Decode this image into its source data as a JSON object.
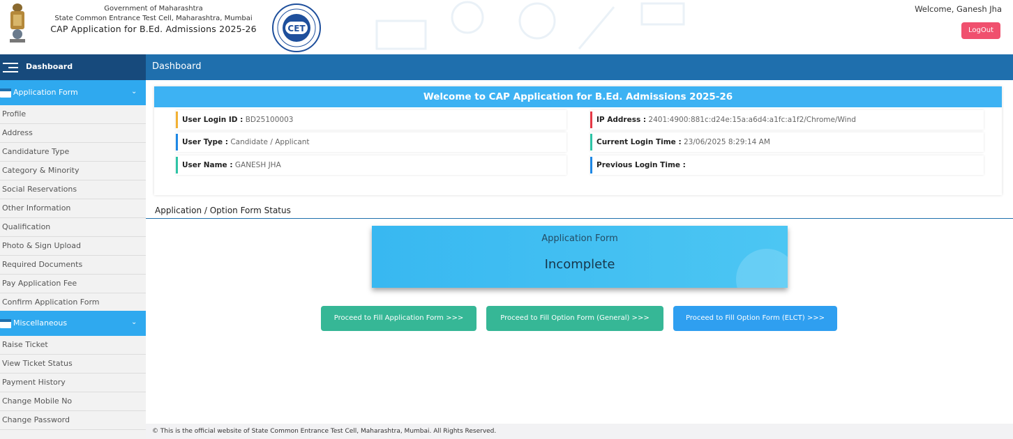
{
  "header": {
    "gov_line": "Government of Maharashtra",
    "cell_line": "State Common Entrance Test Cell, Maharashtra, Mumbai",
    "app_line": "CAP Application for B.Ed. Admissions 2025-26",
    "cet_logo_text": "CET",
    "welcome_text": "Welcome, Ganesh Jha",
    "logout_label": "LogOut",
    "emblem_icon": "state-emblem-icon"
  },
  "nav": {
    "sidebar_title": "Dashboard",
    "page_title": "Dashboard"
  },
  "sidebar": {
    "sections": [
      {
        "label": "Application Form",
        "items": [
          "Profile",
          "Address",
          "Candidature Type",
          "Category & Minority",
          "Social Reservations",
          "Other Information",
          "Qualification",
          "Photo & Sign Upload",
          "Required Documents",
          "Pay Application Fee",
          "Confirm Application Form"
        ]
      },
      {
        "label": "Miscellaneous",
        "items": [
          "Raise Ticket",
          "View Ticket Status",
          "Payment History",
          "Change Mobile No",
          "Change Password"
        ]
      }
    ]
  },
  "welcome_card": {
    "title": "Welcome to CAP Application for B.Ed. Admissions 2025-26",
    "login_id_key": "User Login ID :",
    "login_id_val": "BD25100003",
    "ip_key": "IP Address :",
    "ip_val": "2401:4900:881c:d24e:15a:a6d4:a1fc:a1f2/Chrome/Wind",
    "user_type_key": "User Type :",
    "user_type_val": "Candidate / Applicant",
    "curr_login_key": "Current Login Time :",
    "curr_login_val": "23/06/2025 8:29:14 AM",
    "user_name_key": "User Name :",
    "user_name_val": "GANESH JHA",
    "prev_login_key": "Previous Login Time :",
    "prev_login_val": ""
  },
  "status": {
    "section_title": "Application / Option Form Status",
    "card_label": "Application Form",
    "card_value": "Incomplete",
    "buttons": {
      "fill_application": "Proceed to Fill Application Form >>>",
      "fill_option_general": "Proceed to Fill Option Form (General) >>>",
      "fill_option_elct": "Proceed to Fill Option Form (ELCT) >>>"
    }
  },
  "footer": {
    "text": "© This is the official website of State Common Entrance Test Cell, Maharashtra, Mumbai. All Rights Reserved."
  },
  "colors": {
    "primary_blue": "#1f6fad",
    "sidebar_dark": "#174a7c",
    "accent_blue": "#2fa9ef",
    "green": "#36b796",
    "logout_red": "#f0506e",
    "bar_yellow": "#f2b134",
    "bar_red": "#e63946",
    "bar_blue": "#1e88e5",
    "bar_green": "#2ec4a6"
  }
}
